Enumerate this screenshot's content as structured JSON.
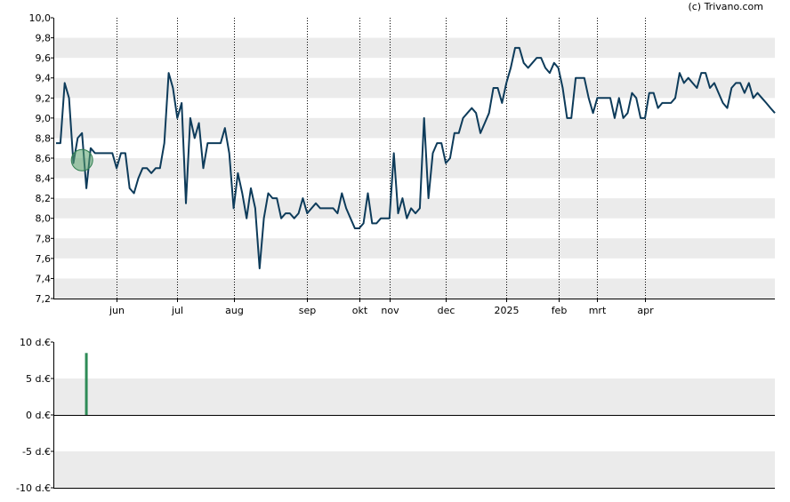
{
  "copyright": "(c) Trivano.com",
  "colors": {
    "price_line": "#0d3b5a",
    "band": "#ebebeb",
    "dividend_bar": "#2e8b57",
    "marker_fill": "#5aa36d",
    "marker_stroke": "#2e7d4f"
  },
  "chart_data": [
    {
      "type": "line",
      "title": "",
      "ylim": [
        7.2,
        10.0
      ],
      "y_ticks": [
        "10,0",
        "9,8",
        "9,6",
        "9,4",
        "9,2",
        "9,0",
        "8,8",
        "8,6",
        "8,4",
        "8,2",
        "8,0",
        "7,8",
        "7,6",
        "7,4",
        "7,2"
      ],
      "x_ticks": [
        {
          "label": "jun",
          "index": 14
        },
        {
          "label": "jul",
          "index": 28
        },
        {
          "label": "aug",
          "index": 41
        },
        {
          "label": "sep",
          "index": 58
        },
        {
          "label": "okt",
          "index": 70
        },
        {
          "label": "nov",
          "index": 77
        },
        {
          "label": "dec",
          "index": 90
        },
        {
          "label": "2025",
          "index": 104
        },
        {
          "label": "feb",
          "index": 116
        },
        {
          "label": "mrt",
          "index": 125
        },
        {
          "label": "apr",
          "index": 136
        }
      ],
      "grid": true,
      "marker": {
        "index": 6,
        "value": 8.58
      },
      "series": [
        {
          "values": [
            8.75,
            8.75,
            9.35,
            9.2,
            8.55,
            8.8,
            8.85,
            8.3,
            8.7,
            8.65,
            8.65,
            8.65,
            8.65,
            8.65,
            8.5,
            8.65,
            8.65,
            8.3,
            8.25,
            8.4,
            8.5,
            8.5,
            8.45,
            8.5,
            8.5,
            8.75,
            9.45,
            9.3,
            9.0,
            9.15,
            8.15,
            9.0,
            8.8,
            8.95,
            8.5,
            8.75,
            8.75,
            8.75,
            8.75,
            8.9,
            8.65,
            8.1,
            8.45,
            8.25,
            8.0,
            8.3,
            8.1,
            7.5,
            8.0,
            8.25,
            8.2,
            8.2,
            8.0,
            8.05,
            8.05,
            8.0,
            8.05,
            8.2,
            8.05,
            8.1,
            8.15,
            8.1,
            8.1,
            8.1,
            8.1,
            8.05,
            8.25,
            8.1,
            8.0,
            7.9,
            7.9,
            7.95,
            8.25,
            7.95,
            7.95,
            8.0,
            8.0,
            8.0,
            8.65,
            8.05,
            8.2,
            8.0,
            8.1,
            8.05,
            8.1,
            9.0,
            8.2,
            8.65,
            8.75,
            8.75,
            8.55,
            8.6,
            8.85,
            8.85,
            9.0,
            9.05,
            9.1,
            9.05,
            8.85,
            8.95,
            9.05,
            9.3,
            9.3,
            9.15,
            9.35,
            9.5,
            9.7,
            9.7,
            9.55,
            9.5,
            9.55,
            9.6,
            9.6,
            9.5,
            9.45,
            9.55,
            9.5,
            9.3,
            9.0,
            9.0,
            9.4,
            9.4,
            9.4,
            9.2,
            9.05,
            9.2,
            9.2,
            9.2,
            9.2,
            9.0,
            9.2,
            9.0,
            9.05,
            9.25,
            9.2,
            9.0,
            9.0,
            9.25,
            9.25,
            9.1,
            9.15,
            9.15,
            9.15,
            9.2,
            9.45,
            9.35,
            9.4,
            9.35,
            9.3,
            9.45,
            9.45,
            9.3,
            9.35,
            9.25,
            9.15,
            9.1,
            9.3,
            9.35,
            9.35,
            9.25,
            9.35,
            9.2,
            9.25,
            9.2,
            9.15,
            9.1,
            9.05
          ]
        }
      ]
    },
    {
      "type": "bar",
      "title": "",
      "ylim": [
        -10,
        10
      ],
      "y_ticks": [
        "10 d.€",
        "5 d.€",
        "0 d.€",
        "-5 d.€",
        "-10 d.€"
      ],
      "bars": [
        {
          "index": 7,
          "value": 8.5
        }
      ]
    }
  ]
}
